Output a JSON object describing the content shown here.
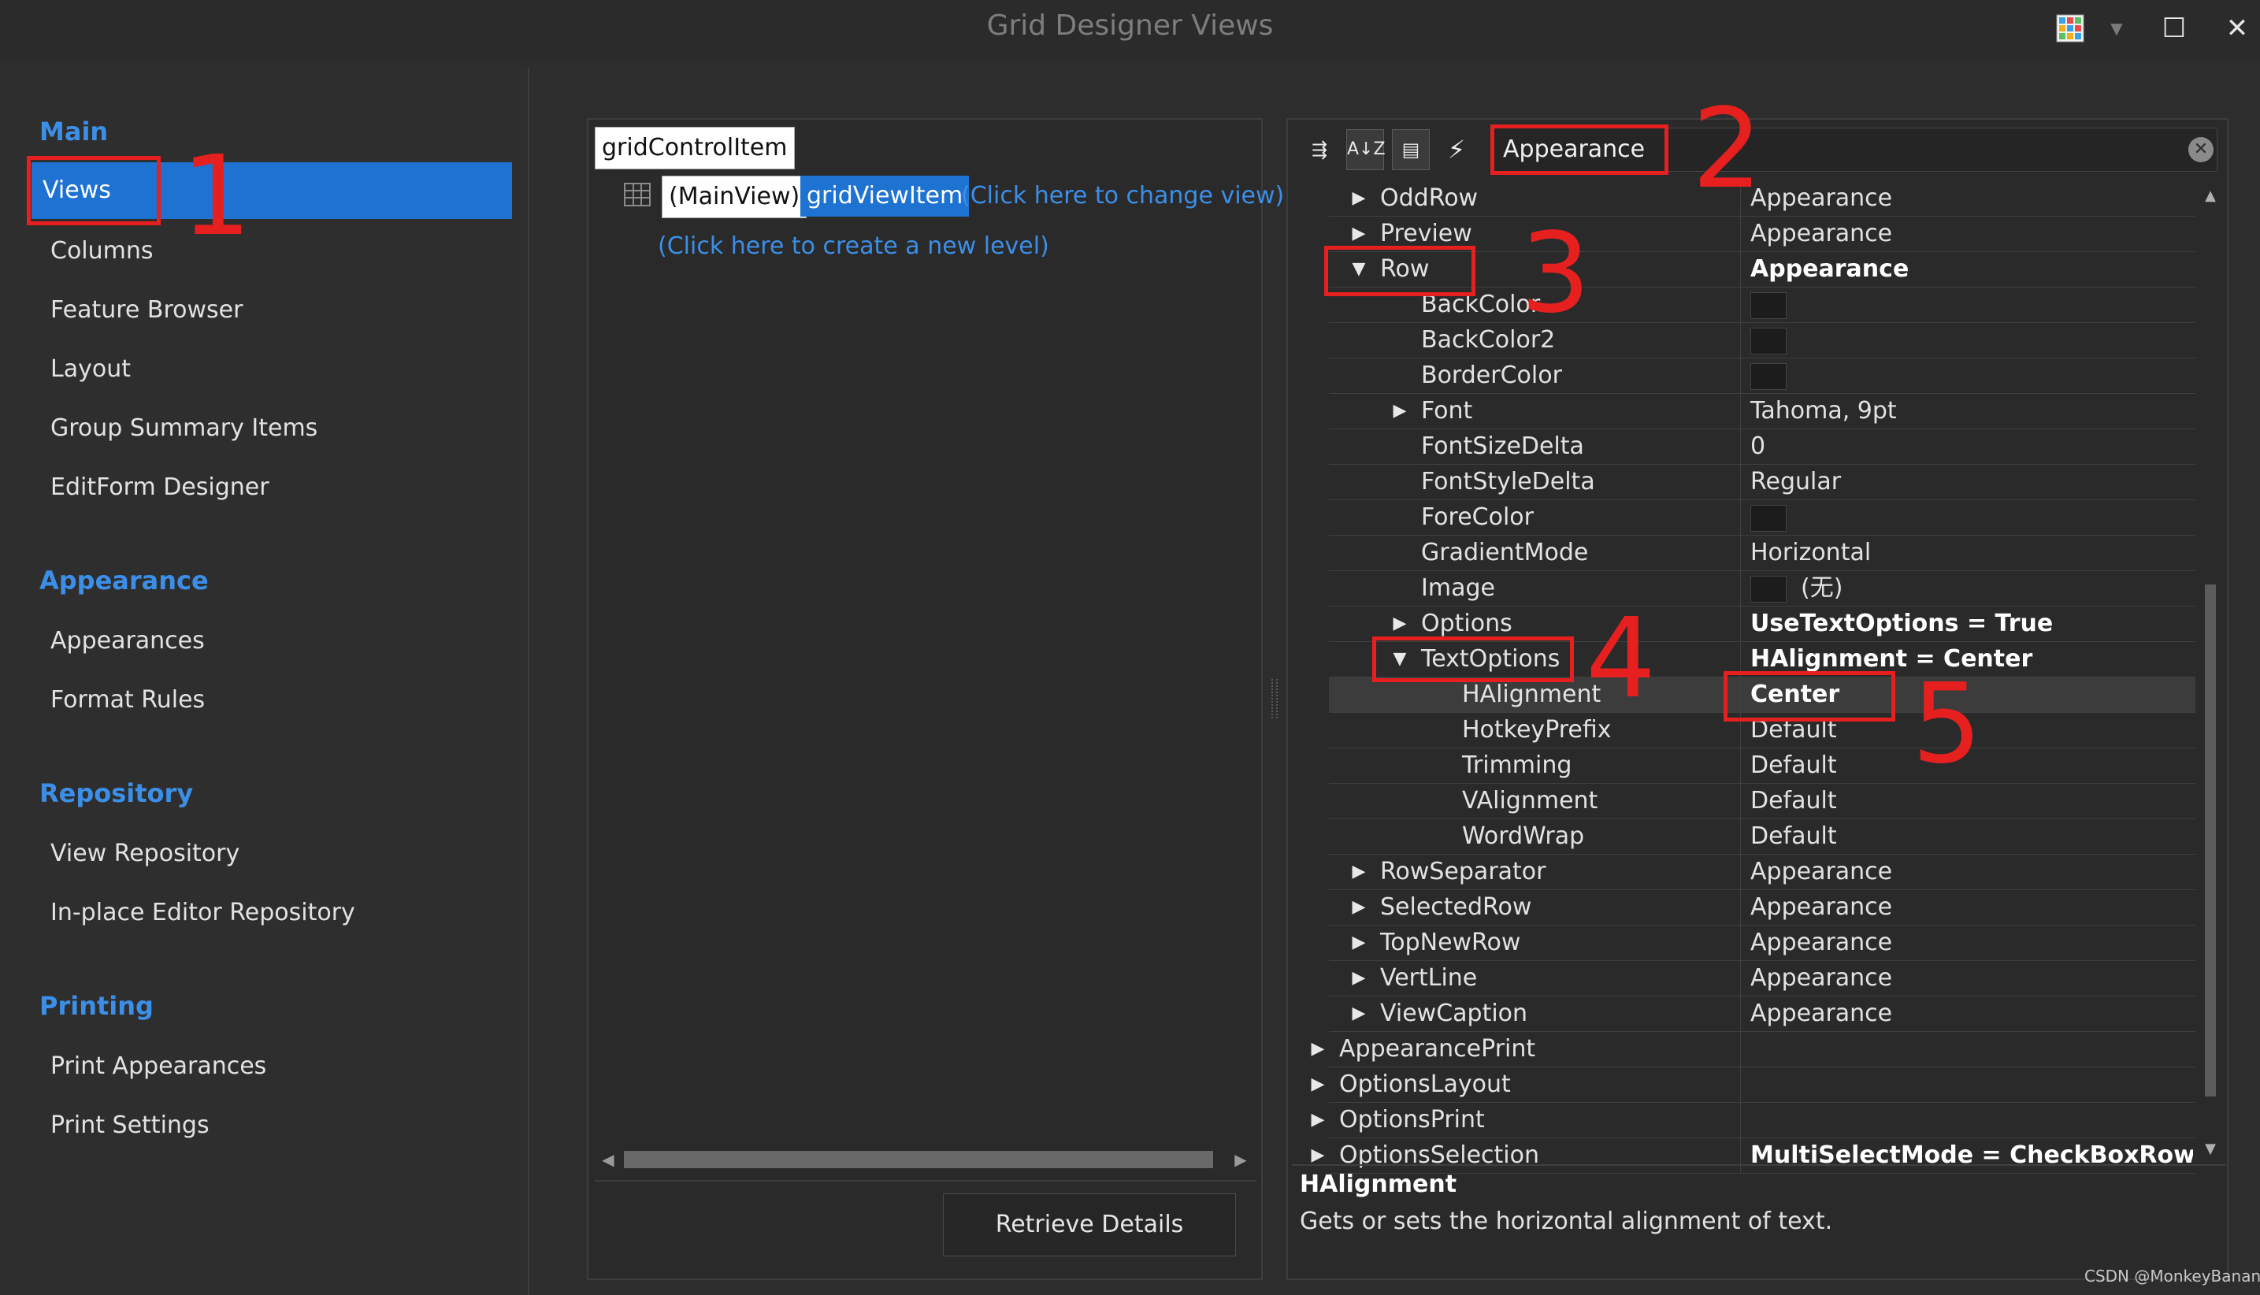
{
  "window": {
    "title": "Grid Designer Views",
    "buttons": {
      "maximize": "☐",
      "close": "✕"
    }
  },
  "nav": {
    "sections": [
      {
        "heading": "Main",
        "items": [
          "Views",
          "Columns",
          "Feature Browser",
          "Layout",
          "Group Summary Items",
          "EditForm Designer"
        ]
      },
      {
        "heading": "Appearance",
        "items": [
          "Appearances",
          "Format Rules"
        ]
      },
      {
        "heading": "Repository",
        "items": [
          "View Repository",
          "In-place Editor Repository"
        ]
      },
      {
        "heading": "Printing",
        "items": [
          "Print Appearances",
          "Print Settings"
        ]
      }
    ],
    "selected": "Views"
  },
  "tree": {
    "root": "gridControlItem",
    "main_view": "(MainView)",
    "view_item": "gridViewItem",
    "change_view_link": "(Click here to change view)",
    "new_level_link": "(Click here to create a new level)",
    "retrieve_button": "Retrieve Details"
  },
  "propgrid": {
    "search_value": "Appearance",
    "rows": [
      {
        "name": "OddRow",
        "value": "Appearance",
        "expander": "▶",
        "bold": false
      },
      {
        "name": "Preview",
        "value": "Appearance",
        "expander": "▶",
        "bold": false
      },
      {
        "name": "Row",
        "value": "Appearance",
        "expander": "▼",
        "bold": true
      },
      {
        "name": "BackColor",
        "value": "",
        "expander": "",
        "bold": false,
        "swatch": true
      },
      {
        "name": "BackColor2",
        "value": "",
        "expander": "",
        "bold": false,
        "swatch": true
      },
      {
        "name": "BorderColor",
        "value": "",
        "expander": "",
        "bold": false,
        "swatch": true
      },
      {
        "name": "Font",
        "value": "Tahoma, 9pt",
        "expander": "▶",
        "bold": false
      },
      {
        "name": "FontSizeDelta",
        "value": "0",
        "expander": "",
        "bold": false
      },
      {
        "name": "FontStyleDelta",
        "value": "Regular",
        "expander": "",
        "bold": false
      },
      {
        "name": "ForeColor",
        "value": "",
        "expander": "",
        "bold": false,
        "swatch": true
      },
      {
        "name": "GradientMode",
        "value": "Horizontal",
        "expander": "",
        "bold": false
      },
      {
        "name": "Image",
        "value": "(无)",
        "expander": "",
        "bold": false,
        "swatch": true
      },
      {
        "name": "Options",
        "value": "UseTextOptions = True",
        "expander": "▶",
        "bold": true
      },
      {
        "name": "TextOptions",
        "value": "HAlignment = Center",
        "expander": "▼",
        "bold": true
      },
      {
        "name": "HAlignment",
        "value": "Center",
        "expander": "",
        "bold": true,
        "selected": true
      },
      {
        "name": "HotkeyPrefix",
        "value": "Default",
        "expander": "",
        "bold": false
      },
      {
        "name": "Trimming",
        "value": "Default",
        "expander": "",
        "bold": false
      },
      {
        "name": "VAlignment",
        "value": "Default",
        "expander": "",
        "bold": false
      },
      {
        "name": "WordWrap",
        "value": "Default",
        "expander": "",
        "bold": false
      },
      {
        "name": "RowSeparator",
        "value": "Appearance",
        "expander": "▶",
        "bold": false
      },
      {
        "name": "SelectedRow",
        "value": "Appearance",
        "expander": "▶",
        "bold": false
      },
      {
        "name": "TopNewRow",
        "value": "Appearance",
        "expander": "▶",
        "bold": false
      },
      {
        "name": "VertLine",
        "value": "Appearance",
        "expander": "▶",
        "bold": false
      },
      {
        "name": "ViewCaption",
        "value": "Appearance",
        "expander": "▶",
        "bold": false
      },
      {
        "name": "AppearancePrint",
        "value": "",
        "expander": "▶",
        "bold": false
      },
      {
        "name": "OptionsLayout",
        "value": "",
        "expander": "▶",
        "bold": false
      },
      {
        "name": "OptionsPrint",
        "value": "",
        "expander": "▶",
        "bold": false
      },
      {
        "name": "OptionsSelection",
        "value": "MultiSelectMode = CheckBoxRowSel",
        "expander": "▶",
        "bold": true
      }
    ],
    "description_title": "HAlignment",
    "description_text": "Gets or sets the horizontal alignment of text."
  },
  "annotations": [
    "1",
    "2",
    "3",
    "4",
    "5"
  ],
  "watermark": "CSDN @MonkeyBananas",
  "colors": {
    "accent": "#1e72d2",
    "heading": "#3c8fe8",
    "link": "#3c8fe8",
    "annotation": "#e5201f"
  }
}
